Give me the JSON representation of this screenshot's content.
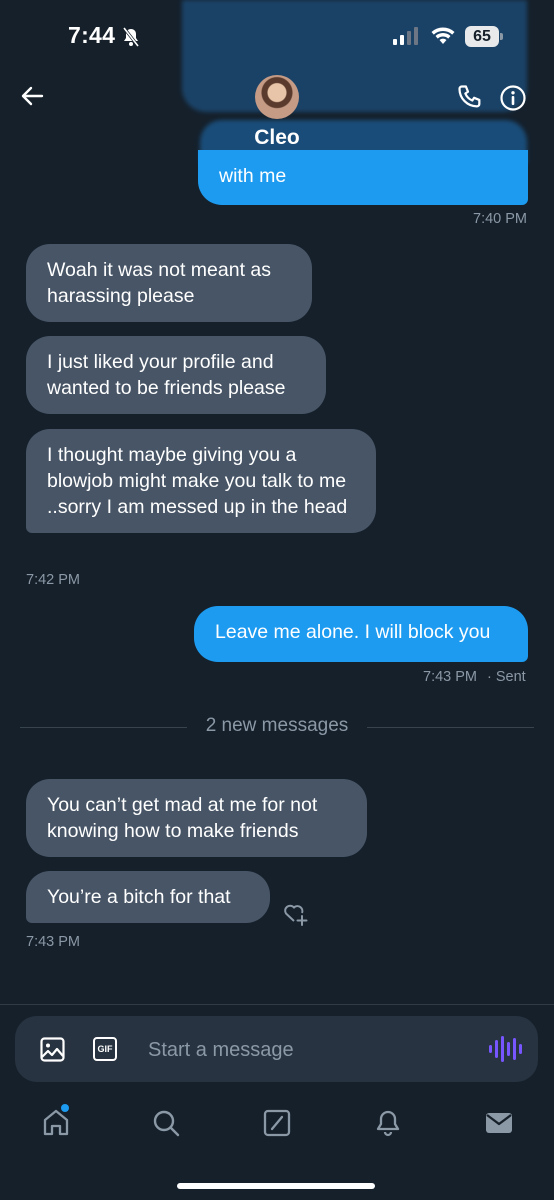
{
  "status_bar": {
    "time": "7:44",
    "battery": "65"
  },
  "header": {
    "contact_name": "Cleo"
  },
  "messages": {
    "sent_1": "with me",
    "stamp_1": "7:40 PM",
    "recv_1": "Woah it was not meant as harassing please",
    "recv_2": "I just liked your profile and wanted to be friends please",
    "recv_3": "I thought maybe giving you a blowjob might make you talk to me ..sorry I am messed up in the head",
    "stamp_2": "7:42 PM",
    "sent_2": "Leave me alone. I will block you",
    "stamp_3": "7:43 PM",
    "sent_status": "· Sent",
    "divider": "2 new messages",
    "recv_4": "You can’t get mad at me for not knowing how to make friends",
    "recv_5": "You’re a bitch for that",
    "stamp_4": "7:43 PM"
  },
  "composer": {
    "placeholder": "Start a message",
    "gif_label": "GIF"
  },
  "icons": {
    "back": "arrow-left-icon",
    "call": "phone-icon",
    "info": "info-icon",
    "react": "heart-plus-icon",
    "image": "image-icon",
    "voice": "voice-icon",
    "tabs": [
      "home-icon",
      "search-icon",
      "compose-icon",
      "bell-icon",
      "mail-icon"
    ]
  },
  "colors": {
    "background": "#15202b",
    "sent_bubble": "#1d9bf0",
    "received_bubble": "#475566",
    "accent_voice": "#7856ff"
  }
}
